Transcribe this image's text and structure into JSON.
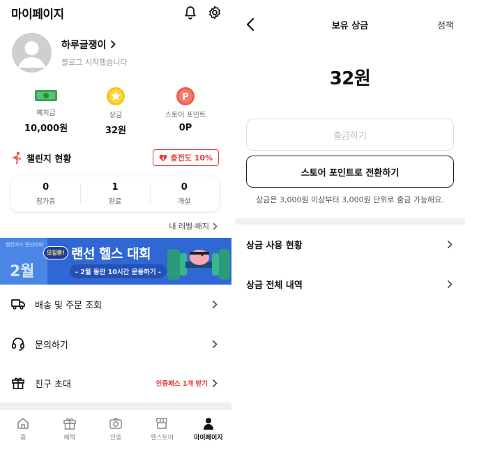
{
  "left": {
    "header": {
      "title": "마이페이지"
    },
    "profile": {
      "name": "하루글쟁이",
      "subtitle": "블로그 시작했습니다"
    },
    "stats": [
      {
        "label": "예치금",
        "value": "10,000원",
        "icon": "money-icon",
        "color": "#3aa55a"
      },
      {
        "label": "상금",
        "value": "32원",
        "icon": "star-coin-icon",
        "color": "#f5c518"
      },
      {
        "label": "스토어 포인트",
        "value": "0P",
        "icon": "point-coin-icon",
        "color": "#f05a4f"
      }
    ],
    "challenge": {
      "title": "챌린지 현황",
      "badge": "충전도 10%"
    },
    "counts": [
      {
        "value": "0",
        "label": "참가중"
      },
      {
        "value": "1",
        "label": "완료"
      },
      {
        "value": "0",
        "label": "개설"
      }
    ],
    "level_link": "내 레벨·배지",
    "banner": {
      "month": "2월",
      "mini": "챌린저스 랜선대회",
      "recruit": "모집중!",
      "title": "랜선 헬스 대회",
      "subtitle": "- 2월 동안 10시간 운동하기 -"
    },
    "menu": [
      {
        "label": "배송 및 주문 조회",
        "icon": "truck-icon"
      },
      {
        "label": "문의하기",
        "icon": "headset-icon"
      },
      {
        "label": "친구 초대",
        "icon": "gift-icon",
        "promo": "인증패스 1개 받기"
      }
    ],
    "tabs": [
      {
        "label": "홈",
        "icon": "home-icon"
      },
      {
        "label": "혜택",
        "icon": "gift-box-icon"
      },
      {
        "label": "인증",
        "icon": "camera-icon"
      },
      {
        "label": "헬스토어",
        "icon": "store-icon"
      },
      {
        "label": "마이페이지",
        "icon": "person-icon",
        "active": true
      }
    ]
  },
  "right": {
    "header": {
      "title": "보유 상금",
      "policy": "정책"
    },
    "amount": "32원",
    "withdraw_button": "출금하기",
    "convert_button": "스토어 포인트로 전환하기",
    "note": "상금은 3,000원 이상부터 3,000원 단위로 출금 가능해요.",
    "rows": [
      {
        "label": "상금 사용 현황"
      },
      {
        "label": "상금 전체 내역"
      }
    ]
  }
}
